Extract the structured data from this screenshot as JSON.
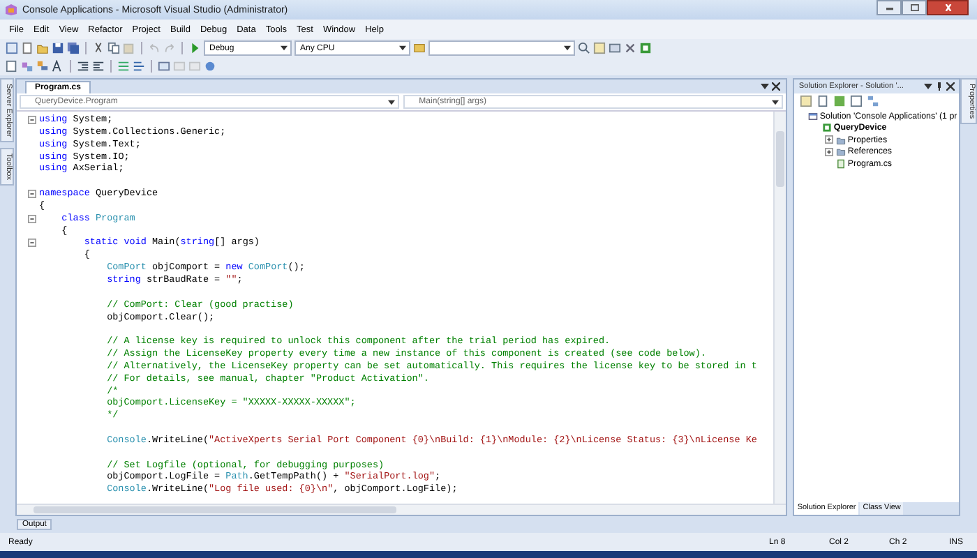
{
  "window": {
    "title": "Console Applications - Microsoft Visual Studio (Administrator)"
  },
  "menu": [
    "File",
    "Edit",
    "View",
    "Refactor",
    "Project",
    "Build",
    "Debug",
    "Data",
    "Tools",
    "Test",
    "Window",
    "Help"
  ],
  "toolbar": {
    "configuration": "Debug",
    "platform": "Any CPU"
  },
  "side_rail_left": [
    "Server Explorer",
    "Toolbox"
  ],
  "side_rail_right": [
    "Properties"
  ],
  "editor": {
    "tabs": [
      {
        "label": "Program.cs",
        "selected": true
      }
    ],
    "nav_class": "QueryDevice.Program",
    "nav_member": "Main(string[] args)",
    "lines": [
      {
        "fold": true,
        "tokens": [
          {
            "kind": "kw",
            "t": "using"
          },
          {
            "kind": "plain",
            "t": " System;"
          }
        ]
      },
      {
        "fold": false,
        "tokens": [
          {
            "kind": "kw",
            "t": "using"
          },
          {
            "kind": "plain",
            "t": " System.Collections.Generic;"
          }
        ]
      },
      {
        "fold": false,
        "tokens": [
          {
            "kind": "kw",
            "t": "using"
          },
          {
            "kind": "plain",
            "t": " System.Text;"
          }
        ]
      },
      {
        "fold": false,
        "tokens": [
          {
            "kind": "kw",
            "t": "using"
          },
          {
            "kind": "plain",
            "t": " System.IO;"
          }
        ]
      },
      {
        "fold": false,
        "tokens": [
          {
            "kind": "kw",
            "t": "using"
          },
          {
            "kind": "plain",
            "t": " AxSerial;"
          }
        ]
      },
      {
        "fold": false
      },
      {
        "fold": true,
        "tokens": [
          {
            "kind": "kw",
            "t": "namespace"
          },
          {
            "kind": "plain",
            "t": " QueryDevice"
          }
        ]
      },
      {
        "fold": false,
        "tokens": [
          {
            "kind": "plain",
            "t": "{"
          }
        ]
      },
      {
        "fold": true,
        "tokens": [
          {
            "kind": "kw",
            "t": "    class"
          },
          {
            "kind": "type",
            "t": " Program"
          }
        ]
      },
      {
        "fold": false,
        "tokens": [
          {
            "kind": "plain",
            "t": "    {"
          }
        ]
      },
      {
        "fold": true,
        "tokens": [
          {
            "kind": "kw",
            "t": "        static void"
          },
          {
            "kind": "plain",
            "t": " Main("
          },
          {
            "kind": "kw",
            "t": "string"
          },
          {
            "kind": "plain",
            "t": "[] args)"
          }
        ]
      },
      {
        "fold": false,
        "tokens": [
          {
            "kind": "plain",
            "t": "        {"
          }
        ]
      },
      {
        "fold": false,
        "tokens": [
          {
            "kind": "type",
            "t": "            ComPort"
          },
          {
            "kind": "plain",
            "t": " objComport = "
          },
          {
            "kind": "kw",
            "t": "new"
          },
          {
            "kind": "type",
            "t": " ComPort"
          },
          {
            "kind": "plain",
            "t": "();"
          }
        ]
      },
      {
        "fold": false,
        "tokens": [
          {
            "kind": "kw",
            "t": "            string"
          },
          {
            "kind": "plain",
            "t": " strBaudRate = "
          },
          {
            "kind": "str",
            "t": "\"\""
          },
          {
            "kind": "plain",
            "t": ";"
          }
        ]
      },
      {
        "fold": false
      },
      {
        "fold": false,
        "tokens": [
          {
            "kind": "comment",
            "t": "            // ComPort: Clear (good practise)"
          }
        ]
      },
      {
        "fold": false,
        "tokens": [
          {
            "kind": "plain",
            "t": "            objComport.Clear();"
          }
        ]
      },
      {
        "fold": false
      },
      {
        "fold": false,
        "tokens": [
          {
            "kind": "comment",
            "t": "            // A license key is required to unlock this component after the trial period has expired."
          }
        ]
      },
      {
        "fold": false,
        "tokens": [
          {
            "kind": "comment",
            "t": "            // Assign the LicenseKey property every time a new instance of this component is created (see code below)."
          }
        ]
      },
      {
        "fold": false,
        "tokens": [
          {
            "kind": "comment",
            "t": "            // Alternatively, the LicenseKey property can be set automatically. This requires the license key to be stored in t"
          }
        ]
      },
      {
        "fold": false,
        "tokens": [
          {
            "kind": "comment",
            "t": "            // For details, see manual, chapter \"Product Activation\"."
          }
        ]
      },
      {
        "fold": false,
        "tokens": [
          {
            "kind": "comment",
            "t": "            /*"
          }
        ]
      },
      {
        "fold": false,
        "tokens": [
          {
            "kind": "comment",
            "t": "            objComport.LicenseKey = \"XXXXX-XXXXX-XXXXX\";"
          }
        ]
      },
      {
        "fold": false,
        "tokens": [
          {
            "kind": "comment",
            "t": "            */"
          }
        ]
      },
      {
        "fold": false
      },
      {
        "fold": false,
        "tokens": [
          {
            "kind": "type",
            "t": "            Console"
          },
          {
            "kind": "plain",
            "t": ".WriteLine("
          },
          {
            "kind": "str",
            "t": "\"ActiveXperts Serial Port Component {0}\\nBuild: {1}\\nModule: {2}\\nLicense Status: {3}\\nLicense Ke"
          }
        ]
      },
      {
        "fold": false
      },
      {
        "fold": false,
        "tokens": [
          {
            "kind": "comment",
            "t": "            // Set Logfile (optional, for debugging purposes)"
          }
        ]
      },
      {
        "fold": false,
        "tokens": [
          {
            "kind": "plain",
            "t": "            objComport.LogFile = "
          },
          {
            "kind": "type",
            "t": "Path"
          },
          {
            "kind": "plain",
            "t": ".GetTempPath() + "
          },
          {
            "kind": "str",
            "t": "\"SerialPort.log\""
          },
          {
            "kind": "plain",
            "t": ";"
          }
        ]
      },
      {
        "fold": false,
        "tokens": [
          {
            "kind": "type",
            "t": "            Console"
          },
          {
            "kind": "plain",
            "t": ".WriteLine("
          },
          {
            "kind": "str",
            "t": "\"Log file used: {0}\\n\""
          },
          {
            "kind": "plain",
            "t": ", objComport.LogFile);"
          }
        ]
      }
    ]
  },
  "solution_explorer": {
    "title": "Solution Explorer - Solution '...",
    "tree": [
      {
        "label": "Solution 'Console Applications' (1 pr",
        "kind": "solution",
        "children": [
          {
            "label": "QueryDevice",
            "kind": "project",
            "children": [
              {
                "label": "Properties",
                "kind": "folder",
                "expanded": false
              },
              {
                "label": "References",
                "kind": "folder",
                "expanded": false
              },
              {
                "label": "Program.cs",
                "kind": "file"
              }
            ]
          }
        ]
      }
    ],
    "bottom_tabs": [
      {
        "label": "Solution Explorer",
        "selected": true
      },
      {
        "label": "Class View",
        "selected": false
      }
    ]
  },
  "output_tab": "Output",
  "status_bar": {
    "message": "Ready",
    "line": "Ln 8",
    "column": "Col 2",
    "char": "Ch 2",
    "mode": "INS"
  }
}
